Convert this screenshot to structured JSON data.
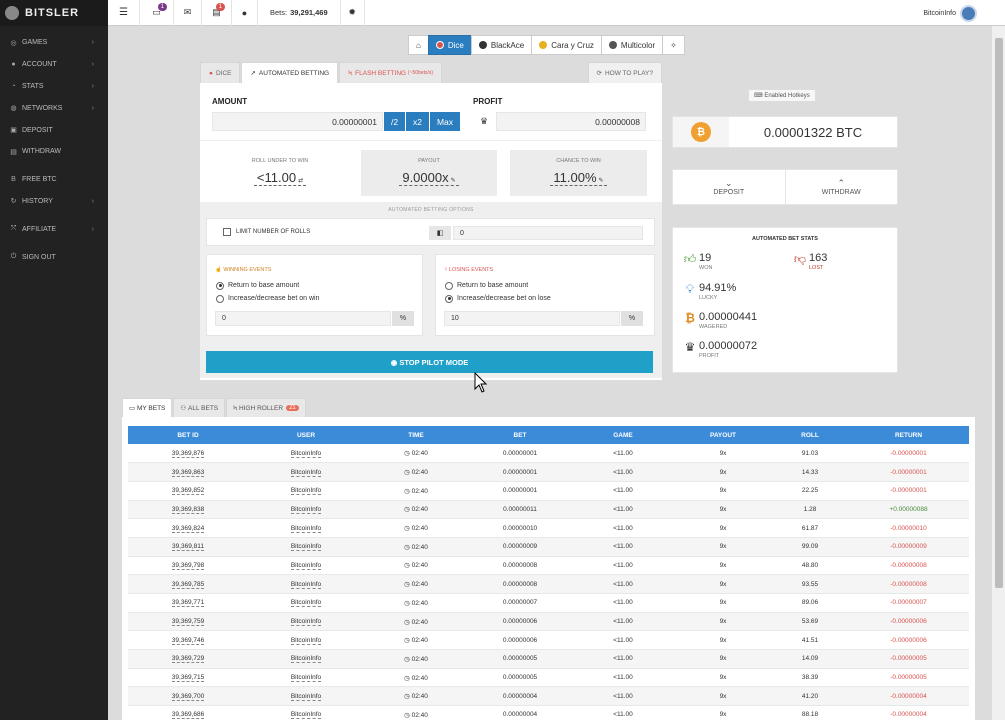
{
  "brand": {
    "name": "BITSLER"
  },
  "sidebar": {
    "items": [
      {
        "label": "GAMES",
        "icon": "gamepad-icon",
        "glyph": "◎",
        "chevron": true
      },
      {
        "label": "ACCOUNT",
        "icon": "user-icon",
        "glyph": "●",
        "chevron": true
      },
      {
        "label": "STATS",
        "icon": "stats-icon",
        "glyph": "◔",
        "chevron": true
      },
      {
        "label": "NETWORKS",
        "icon": "network-icon",
        "glyph": "◍",
        "chevron": true
      },
      {
        "label": "DEPOSIT",
        "icon": "deposit-icon",
        "glyph": "▣",
        "chevron": false
      },
      {
        "label": "WITHDRAW",
        "icon": "withdraw-icon",
        "glyph": "▤",
        "chevron": false
      },
      {
        "label": "FREE BTC",
        "icon": "bitcoin-icon",
        "glyph": "B",
        "chevron": false
      },
      {
        "label": "HISTORY",
        "icon": "history-icon",
        "glyph": "↻",
        "chevron": true
      },
      {
        "label": "AFFILIATE",
        "icon": "affiliate-icon",
        "glyph": "⤧",
        "chevron": true
      },
      {
        "label": "SIGN OUT",
        "icon": "sign-out-icon",
        "glyph": "⏻",
        "chevron": false
      }
    ]
  },
  "topbar": {
    "chat_badge": "1",
    "notif_badge": "1",
    "bets_label": "Bets:",
    "bets_value": "39,291,469",
    "username": "BitcoinInfo"
  },
  "games": [
    {
      "label": "",
      "icon": "home-icon",
      "active": false
    },
    {
      "label": "Dice",
      "icon": "dice-icon",
      "active": true,
      "color": "#d9534f"
    },
    {
      "label": "BlackAce",
      "icon": "blackace-icon",
      "active": false,
      "color": "#333333"
    },
    {
      "label": "Cara y Cruz",
      "icon": "coin-icon",
      "active": false,
      "color": "#e8b020"
    },
    {
      "label": "Multicolor",
      "icon": "multicolor-icon",
      "active": false,
      "color": "#555555"
    },
    {
      "label": "",
      "icon": "lightbulb-icon",
      "active": false
    }
  ],
  "panel_tabs": {
    "dice": "DICE",
    "automated": "AUTOMATED BETTING",
    "flash": "FLASH BETTING",
    "flash_tag": "(~50bets/s)",
    "howto": "HOW TO PLAY?"
  },
  "bet": {
    "amount_label": "AMOUNT",
    "amount_value": "0.00000001",
    "half": "/2",
    "double": "x2",
    "max": "Max",
    "profit_label": "PROFIT",
    "profit_value": "0.00000008"
  },
  "roll": {
    "under_label": "ROLL UNDER TO WIN",
    "under_value": "<11.00",
    "payout_label": "PAYOUT",
    "payout_value": "9.0000x",
    "chance_label": "CHANCE TO WIN",
    "chance_value": "11.00%"
  },
  "auto": {
    "options_label": "AUTOMATED BETTING OPTIONS",
    "limit_label": "LIMIT NUMBER OF ROLLS",
    "limit_value": "0",
    "winning_title": "WINNING EVENTS",
    "win_opt1": "Return to base amount",
    "win_opt2": "Increase/decrease bet on win",
    "win_value": "0",
    "losing_title": "LOSING EVENTS",
    "lose_opt1": "Return to base amount",
    "lose_opt2": "Increase/decrease bet on lose",
    "lose_value": "10",
    "pct": "%",
    "stop_label": "STOP PILOT MODE"
  },
  "right": {
    "hotkeys": "Enabled Hotkeys",
    "balance": "0.00001322 BTC",
    "deposit": "DEPOSIT",
    "withdraw": "WITHDRAW",
    "stats_title": "AUTOMATED BET STATS",
    "won_value": "19",
    "won_label": "WON",
    "lost_value": "163",
    "lost_label": "LOST",
    "lucky_value": "94.91%",
    "lucky_label": "LUCKY",
    "wagered_value": "0.00000441",
    "wagered_label": "WAGERED",
    "profit_value": "0.00000072",
    "profit_label": "PROFIT"
  },
  "bet_tabs": {
    "my": "MY BETS",
    "all": "ALL BETS",
    "high": "HIGH ROLLER",
    "high_count": "21"
  },
  "table": {
    "headers": [
      "BET ID",
      "USER",
      "TIME",
      "BET",
      "GAME",
      "PAYOUT",
      "ROLL",
      "RETURN"
    ],
    "rows": [
      [
        "39,369,876",
        "BitcoinInfo",
        "02:40",
        "0.00000001",
        "<11.00",
        "9x",
        "91.03",
        "-0.00000001"
      ],
      [
        "39,369,863",
        "BitcoinInfo",
        "02:40",
        "0.00000001",
        "<11.00",
        "9x",
        "14.33",
        "-0.00000001"
      ],
      [
        "39,369,852",
        "BitcoinInfo",
        "02:40",
        "0.00000001",
        "<11.00",
        "9x",
        "22.25",
        "-0.00000001"
      ],
      [
        "39,369,838",
        "BitcoinInfo",
        "02:40",
        "0.00000011",
        "<11.00",
        "9x",
        "1.28",
        "+0.00000088"
      ],
      [
        "39,369,824",
        "BitcoinInfo",
        "02:40",
        "0.00000010",
        "<11.00",
        "9x",
        "61.87",
        "-0.00000010"
      ],
      [
        "39,369,811",
        "BitcoinInfo",
        "02:40",
        "0.00000009",
        "<11.00",
        "9x",
        "99.09",
        "-0.00000009"
      ],
      [
        "39,369,798",
        "BitcoinInfo",
        "02:40",
        "0.00000008",
        "<11.00",
        "9x",
        "48.80",
        "-0.00000008"
      ],
      [
        "39,369,785",
        "BitcoinInfo",
        "02:40",
        "0.00000008",
        "<11.00",
        "9x",
        "93.55",
        "-0.00000008"
      ],
      [
        "39,369,771",
        "BitcoinInfo",
        "02:40",
        "0.00000007",
        "<11.00",
        "9x",
        "89.06",
        "-0.00000007"
      ],
      [
        "39,369,759",
        "BitcoinInfo",
        "02:40",
        "0.00000006",
        "<11.00",
        "9x",
        "53.69",
        "-0.00000006"
      ],
      [
        "39,369,746",
        "BitcoinInfo",
        "02:40",
        "0.00000006",
        "<11.00",
        "9x",
        "41.51",
        "-0.00000006"
      ],
      [
        "39,369,729",
        "BitcoinInfo",
        "02:40",
        "0.00000005",
        "<11.00",
        "9x",
        "14.09",
        "-0.00000005"
      ],
      [
        "39,369,715",
        "BitcoinInfo",
        "02:40",
        "0.00000005",
        "<11.00",
        "9x",
        "38.39",
        "-0.00000005"
      ],
      [
        "39,369,700",
        "BitcoinInfo",
        "02:40",
        "0.00000004",
        "<11.00",
        "9x",
        "41.20",
        "-0.00000004"
      ],
      [
        "39,369,686",
        "BitcoinInfo",
        "02:40",
        "0.00000004",
        "<11.00",
        "9x",
        "88.18",
        "-0.00000004"
      ]
    ]
  },
  "colors": {
    "accent": "#2a7ebf",
    "stop": "#1fa0c8",
    "header": "#3b8bd9",
    "negative": "#d9534f",
    "bitcoin": "#f0a030"
  }
}
